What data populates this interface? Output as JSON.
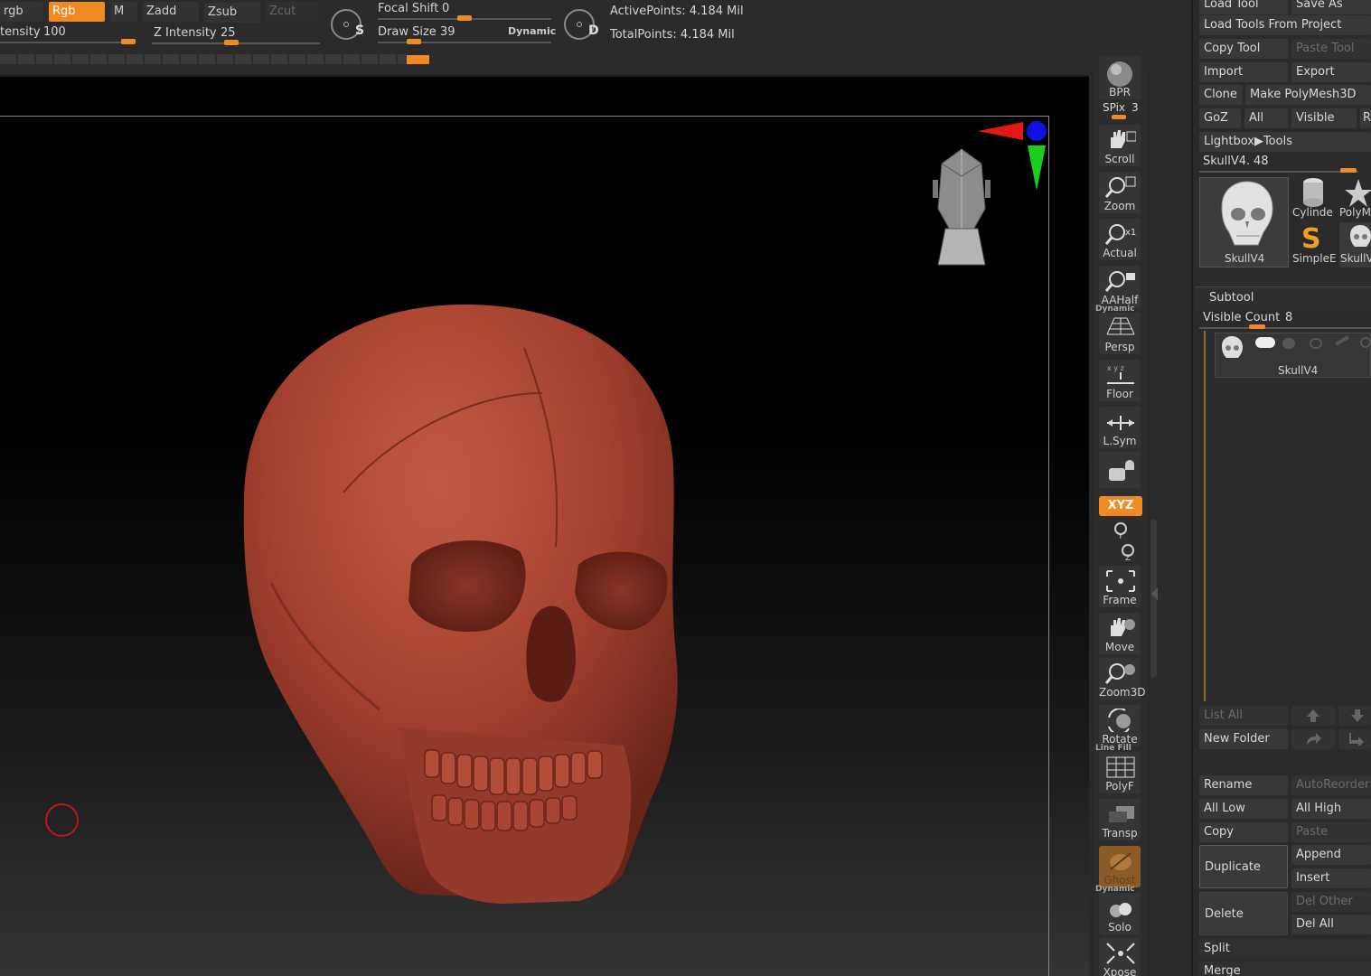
{
  "topbar": {
    "rgb": "rgb",
    "rgb_active": "Rgb",
    "m": "M",
    "zadd": "Zadd",
    "zsub": "Zsub",
    "zcut": "Zcut",
    "intensity_label": "tensity",
    "intensity_value": "100",
    "z_intensity_label": "Z Intensity",
    "z_intensity_value": "25",
    "focal_shift_label": "Focal Shift",
    "focal_shift_value": "0",
    "draw_size_label": "Draw Size",
    "draw_size_value": "39",
    "dynamic": "Dynamic",
    "s_letter": "S",
    "d_letter": "D",
    "active_points": "ActivePoints: 4.184 Mil",
    "total_points": "TotalPoints: 4.184 Mil",
    "accent_color": "#f08a24"
  },
  "shelf": {
    "bpr": "BPR",
    "spix_label": "SPix",
    "spix_value": "3",
    "scroll": "Scroll",
    "zoom": "Zoom",
    "actual": "Actual",
    "aahalf": "AAHalf",
    "persp_top": "Dynamic",
    "persp": "Persp",
    "floor": "Floor",
    "lsym": "L.Sym",
    "xyz": "XYZ",
    "frame": "Frame",
    "move": "Move",
    "zoom3d": "Zoom3D",
    "rotate": "Rotate",
    "polyf_top": "Line Fill",
    "polyf": "PolyF",
    "transp": "Transp",
    "ghost": "Ghost",
    "solo_top": "Dynamic",
    "solo": "Solo",
    "xpose": "Xpose"
  },
  "tray": {
    "load_tool": "Load Tool",
    "save_as": "Save As",
    "load_tools_from_project": "Load Tools From Project",
    "copy_tool": "Copy Tool",
    "paste_tool": "Paste Tool",
    "import": "Import",
    "export": "Export",
    "clone": "Clone",
    "make_polymesh": "Make PolyMesh3D",
    "goz": "GoZ",
    "all": "All",
    "visible": "Visible",
    "r": "R",
    "lightbox_tools": "Lightbox▶Tools",
    "tool_name_label": "SkullV4.",
    "tool_name_value": "48",
    "thumb_skull": "SkullV4",
    "thumb_cylinder": "Cylinde",
    "thumb_polym": "PolyM",
    "thumb_simple": "SimpleE",
    "thumb_skull_small": "SkullV",
    "subtool": "Subtool",
    "visible_count_label": "Visible Count",
    "visible_count_value": "8",
    "subtool_item": "SkullV4",
    "list_all": "List All",
    "new_folder": "New Folder",
    "rename": "Rename",
    "auto_reorder": "AutoReorder",
    "all_low": "All Low",
    "all_high": "All High",
    "copy": "Copy",
    "paste": "Paste",
    "duplicate": "Duplicate",
    "append": "Append",
    "insert": "Insert",
    "delete": "Delete",
    "del_other": "Del Other",
    "del_all": "Del All",
    "split": "Split",
    "merge": "Merge"
  }
}
